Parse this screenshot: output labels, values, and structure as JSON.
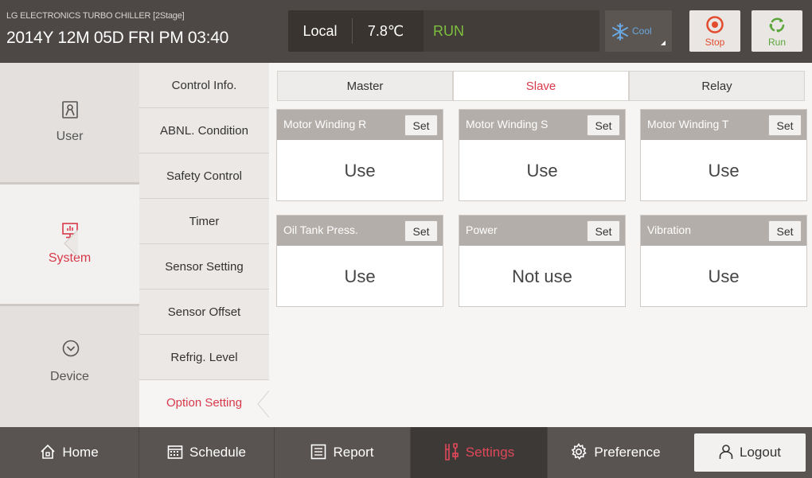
{
  "header": {
    "title": "LG ELECTRONICS TURBO CHILLER [2Stage]",
    "datetime": "2014Y 12M 05D  FRI PM 03:40",
    "control_mode": "Local",
    "temperature": "7.8℃",
    "status": "RUN",
    "operation_mode": "Cool",
    "stop_label": "Stop",
    "run_label": "Run",
    "colors": {
      "run_status": "#7dbf3f",
      "stop": "#e34b2e",
      "run": "#5aa63a",
      "cool": "#6aa6e0"
    }
  },
  "categories": [
    {
      "label": "User",
      "icon": "user-icon",
      "active": false
    },
    {
      "label": "System",
      "icon": "monitor-chart-icon",
      "active": true
    },
    {
      "label": "Device",
      "icon": "chevron-circle-icon",
      "active": false
    }
  ],
  "submenu": [
    {
      "label": "Control Info.",
      "active": false
    },
    {
      "label": "ABNL. Condition",
      "active": false
    },
    {
      "label": "Safety Control",
      "active": false
    },
    {
      "label": "Timer",
      "active": false
    },
    {
      "label": "Sensor Setting",
      "active": false
    },
    {
      "label": "Sensor Offset",
      "active": false
    },
    {
      "label": "Refrig. Level",
      "active": false
    },
    {
      "label": "Option Setting",
      "active": true
    }
  ],
  "tabs": [
    {
      "label": "Master",
      "active": false
    },
    {
      "label": "Slave",
      "active": true
    },
    {
      "label": "Relay",
      "active": false
    }
  ],
  "options": [
    {
      "title": "Motor Winding R",
      "set_label": "Set",
      "value": "Use"
    },
    {
      "title": "Motor Winding S",
      "set_label": "Set",
      "value": "Use"
    },
    {
      "title": "Motor Winding T",
      "set_label": "Set",
      "value": "Use"
    },
    {
      "title": "Oil Tank Press.",
      "set_label": "Set",
      "value": "Use"
    },
    {
      "title": "Power",
      "set_label": "Set",
      "value": "Not use"
    },
    {
      "title": "Vibration",
      "set_label": "Set",
      "value": "Use"
    }
  ],
  "bottom_nav": [
    {
      "label": "Home",
      "icon": "home-icon",
      "active": false
    },
    {
      "label": "Schedule",
      "icon": "calendar-icon",
      "active": false
    },
    {
      "label": "Report",
      "icon": "list-icon",
      "active": false
    },
    {
      "label": "Settings",
      "icon": "settings-tools-icon",
      "active": true
    },
    {
      "label": "Preference",
      "icon": "gear-icon",
      "active": false
    }
  ],
  "logout_label": "Logout",
  "accent_color": "#d8394a"
}
